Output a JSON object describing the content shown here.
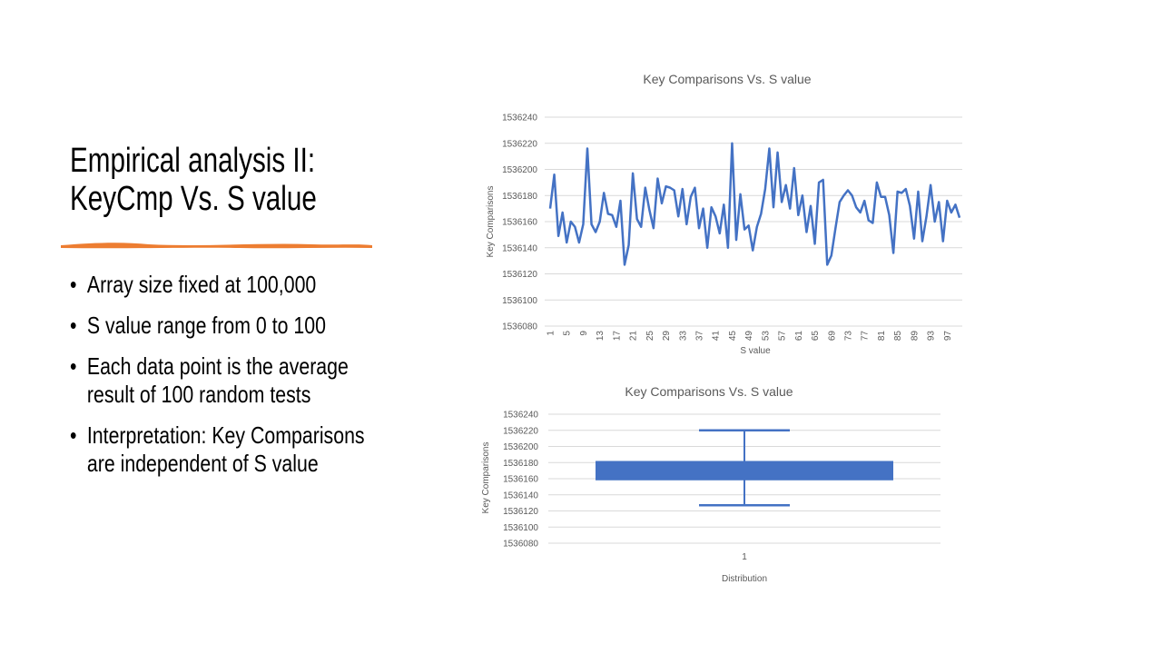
{
  "slide": {
    "title_line1": "Empirical analysis II:",
    "title_line2": "KeyCmp Vs. S value",
    "accent_color": "#ED7D31",
    "bullets": [
      "Array size fixed at 100,000",
      "S value range from 0 to 100",
      "Each data point is the average",
      "result of 100 random tests",
      "Interpretation: Key Comparisons",
      "are independent of S value"
    ]
  },
  "chart_data": [
    {
      "type": "line",
      "title": "Key Comparisons Vs. S value",
      "xlabel": "S value",
      "ylabel": "Key Comparisons",
      "ylim": [
        1536080,
        1536240
      ],
      "yticks": [
        "1536080",
        "1536100",
        "1536120",
        "1536140",
        "1536160",
        "1536180",
        "1536200",
        "1536220",
        "1536240"
      ],
      "xtick_labels": [
        "1",
        "5",
        "9",
        "13",
        "17",
        "21",
        "25",
        "29",
        "33",
        "37",
        "41",
        "45",
        "49",
        "53",
        "57",
        "61",
        "65",
        "69",
        "73",
        "77",
        "81",
        "85",
        "89",
        "93",
        "97"
      ],
      "grid": true,
      "color": "#4472C4",
      "x": [
        1,
        2,
        3,
        4,
        5,
        6,
        7,
        8,
        9,
        10,
        11,
        12,
        13,
        14,
        15,
        16,
        17,
        18,
        19,
        20,
        21,
        22,
        23,
        24,
        25,
        26,
        27,
        28,
        29,
        30,
        31,
        32,
        33,
        34,
        35,
        36,
        37,
        38,
        39,
        40,
        41,
        42,
        43,
        44,
        45,
        46,
        47,
        48,
        49,
        50,
        51,
        52,
        53,
        54,
        55,
        56,
        57,
        58,
        59,
        60,
        61,
        62,
        63,
        64,
        65,
        66,
        67,
        68,
        69,
        70,
        71,
        72,
        73,
        74,
        75,
        76,
        77,
        78,
        79,
        80,
        81,
        82,
        83,
        84,
        85,
        86,
        87,
        88,
        89,
        90,
        91,
        92,
        93,
        94,
        95,
        96,
        97,
        98,
        99,
        100
      ],
      "values": [
        1536170,
        1536196,
        1536149,
        1536167,
        1536144,
        1536160,
        1536156,
        1536144,
        1536158,
        1536216,
        1536158,
        1536152,
        1536160,
        1536182,
        1536166,
        1536165,
        1536156,
        1536176,
        1536127,
        1536142,
        1536197,
        1536162,
        1536156,
        1536186,
        1536169,
        1536155,
        1536193,
        1536174,
        1536187,
        1536186,
        1536184,
        1536164,
        1536185,
        1536158,
        1536179,
        1536186,
        1536155,
        1536170,
        1536140,
        1536171,
        1536164,
        1536151,
        1536173,
        1536140,
        1536220,
        1536146,
        1536181,
        1536154,
        1536157,
        1536138,
        1536156,
        1536166,
        1536185,
        1536216,
        1536171,
        1536213,
        1536175,
        1536188,
        1536170,
        1536201,
        1536165,
        1536180,
        1536152,
        1536172,
        1536143,
        1536190,
        1536192,
        1536127,
        1536134,
        1536155,
        1536175,
        1536180,
        1536184,
        1536180,
        1536171,
        1536167,
        1536176,
        1536161,
        1536159,
        1536190,
        1536179,
        1536179,
        1536165,
        1536136,
        1536183,
        1536182,
        1536185,
        1536172,
        1536147,
        1536183,
        1536145,
        1536164,
        1536188,
        1536160,
        1536175,
        1536145,
        1536176,
        1536167,
        1536173,
        1536163
      ]
    },
    {
      "type": "box",
      "title": "Key Comparisons Vs. S value",
      "xlabel": "Distribution",
      "ylabel": "Key Comparisons",
      "categories": [
        "1"
      ],
      "ylim": [
        1536080,
        1536240
      ],
      "yticks": [
        "1536080",
        "1536100",
        "1536120",
        "1536140",
        "1536160",
        "1536180",
        "1536200",
        "1536220",
        "1536240"
      ],
      "grid": true,
      "color": "#4472C4",
      "min": 1536127,
      "q1": 1536158,
      "q3": 1536182,
      "max": 1536220
    }
  ]
}
